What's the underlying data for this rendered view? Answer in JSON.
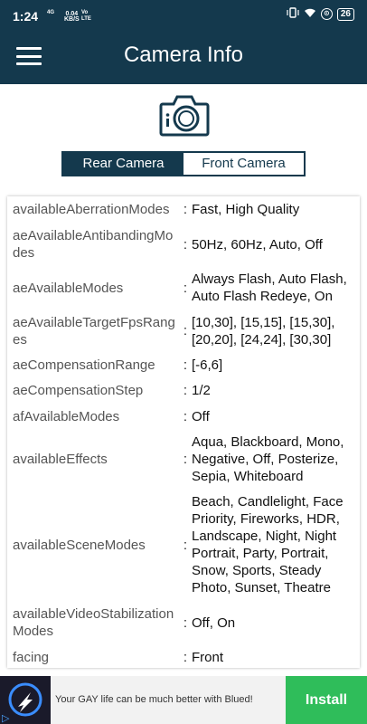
{
  "status_bar": {
    "time": "1:24",
    "indicators": "4G",
    "net_speed": "0.04",
    "net_unit": "KB/S",
    "lte": "Vo LTE",
    "battery": "26",
    "icons": [
      "vibrate-icon",
      "wifi-icon",
      "battery-icon"
    ]
  },
  "app_bar": {
    "title": "Camera Info",
    "menu_icon": "hamburger-menu-icon"
  },
  "header_icon": "camera-icon",
  "tabs": [
    {
      "label": "Rear Camera",
      "active": true
    },
    {
      "label": "Front Camera",
      "active": false
    }
  ],
  "rows": [
    {
      "key": "availableAberrationModes",
      "value": "Fast, High Quality"
    },
    {
      "key": "aeAvailableAntibandingModes",
      "value": "50Hz, 60Hz, Auto, Off"
    },
    {
      "key": "aeAvailableModes",
      "value": "Always Flash, Auto Flash, Auto Flash Redeye, On"
    },
    {
      "key": "aeAvailableTargetFpsRanges",
      "value": "[10,30], [15,15], [15,30], [20,20], [24,24], [30,30]"
    },
    {
      "key": "aeCompensationRange",
      "value": "[-6,6]"
    },
    {
      "key": "aeCompensationStep",
      "value": "1/2"
    },
    {
      "key": "afAvailableModes",
      "value": "Off"
    },
    {
      "key": "availableEffects",
      "value": "Aqua, Blackboard, Mono, Negative, Off, Posterize, Sepia, Whiteboard"
    },
    {
      "key": "availableSceneModes",
      "value": "Beach, Candlelight, Face Priority, Fireworks, HDR, Landscape, Night, Night Portrait, Party, Portrait, Snow, Sports, Steady Photo, Sunset, Theatre"
    },
    {
      "key": "availableVideoStabilizationModes",
      "value": "Off, On"
    },
    {
      "key": "facing",
      "value": "Front"
    }
  ],
  "separator": ":",
  "ad": {
    "text": "Your GAY life can be much better with Blued!",
    "button": "Install",
    "accent": "#2fbd5a"
  },
  "colors": {
    "primary": "#14394d",
    "background": "#ffffff"
  }
}
